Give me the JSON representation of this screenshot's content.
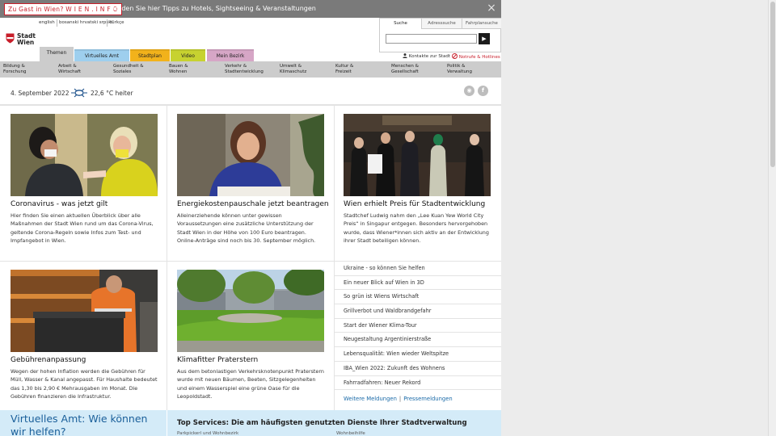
{
  "promo": {
    "link_label": "Zu Gast in Wien? W I E N . I N F O",
    "text": "Finden Sie hier Tipps zu Hotels, Sightseeing & Veranstaltungen",
    "close_icon": "×"
  },
  "languages": [
    "english",
    "bosanski hrvatski srpski",
    "türkçe"
  ],
  "logo": {
    "line1": "Stadt",
    "line2": "Wien",
    "color": "#c81e2a"
  },
  "search": {
    "tabs": [
      "Suche",
      "Adresssuche",
      "Fahrplansuche"
    ],
    "placeholder": "",
    "go_label": "▶"
  },
  "utility": {
    "contact": "Kontakte zur Stadt",
    "emergency": "Notrufe & Hotlines"
  },
  "topnav": [
    {
      "label": "Themen",
      "color": "#cccccc"
    },
    {
      "label": "Virtuelles Amt",
      "color": "#9ecfee"
    },
    {
      "label": "Stadtplan",
      "color": "#f2b21b"
    },
    {
      "label": "Video",
      "color": "#c7d230"
    },
    {
      "label": "Mein Bezirk",
      "color": "#d6a6c6"
    }
  ],
  "categories": [
    {
      "l1": "Bildung &",
      "l2": "Forschung"
    },
    {
      "l1": "Arbeit &",
      "l2": "Wirtschaft"
    },
    {
      "l1": "Gesundheit &",
      "l2": "Soziales"
    },
    {
      "l1": "Bauen &",
      "l2": "Wohnen"
    },
    {
      "l1": "Verkehr &",
      "l2": "Stadtentwicklung"
    },
    {
      "l1": "Umwelt &",
      "l2": "Klimaschutz"
    },
    {
      "l1": "Kultur &",
      "l2": "Freizeit"
    },
    {
      "l1": "Menschen &",
      "l2": "Gesellschaft"
    },
    {
      "l1": "Politik &",
      "l2": "Verwaltung"
    }
  ],
  "info": {
    "date": "4. September 2022",
    "weather": "22,6 °C heiter"
  },
  "social": {
    "rss": "◉",
    "facebook": "f"
  },
  "teasers": [
    {
      "title": "Coronavirus - was jetzt gilt",
      "text": "Hier finden Sie einen aktuellen Überblick über alle Maßnahmen der Stadt Wien rund um das Corona-Virus, geltende Corona-Regeln sowie Infos zum Test- und Impfangebot in Wien."
    },
    {
      "title": "Energiekostenpauschale jetzt beantragen",
      "text": "Alleinerziehende können unter gewissen Voraussetzungen eine zusätzliche Unterstützung der Stadt Wien in der Höhe von 100 Euro beantragen. Online-Anträge sind noch bis 30. September möglich."
    },
    {
      "title": "Wien erhielt Preis für Stadtentwicklung",
      "text": "Stadtchef Ludwig nahm den „Lee Kuan Yew World City Preis“ in Singapur entgegen. Besonders hervorgehoben wurde, dass Wiener*innen sich aktiv an der Entwicklung ihrer Stadt beteiligen können."
    },
    {
      "title": "Gebührenanpassung",
      "text": "Wegen der hohen Inflation werden die Gebühren für Müll, Wasser & Kanal angepasst. Für Haushalte bedeutet das 1,30 bis 2,90 € Mehrausgaben im Monat. Die Gebühren finanzieren die Infrastruktur."
    },
    {
      "title": "Klimafitter Praterstern",
      "text": "Aus dem betonlastigen Verkehrsknotenpunkt Praterstern wurde mit neuen Bäumen, Beeten, Sitzgelegenheiten und einem Wasserspiel eine grüne Oase für die Leopoldstadt."
    }
  ],
  "news": [
    "Ukraine - so können Sie helfen",
    "Ein neuer Blick auf Wien in 3D",
    "So grün ist Wiens Wirtschaft",
    "Grillverbot und Waldbrandgefahr",
    "Start der Wiener Klima-Tour",
    "Neugestaltung Argentinierstraße",
    "Lebensqualität: Wien wieder Weltspitze",
    "IBA_Wien 2022: Zukunft des Wohnens",
    "Fahrradfahren: Neuer Rekord"
  ],
  "news_more": {
    "more": "Weitere Meldungen",
    "sep": "|",
    "press": "Pressemeldungen"
  },
  "bottom": {
    "amt_title": "Virtuelles Amt: Wie können wir helfen?",
    "services_title": "Top Services: Die am häufigsten genutzten Dienste Ihrer Stadtverwaltung",
    "service_links": [
      "Parkpickerl und Wohnbezirk",
      "Wohnbeihilfe"
    ]
  }
}
